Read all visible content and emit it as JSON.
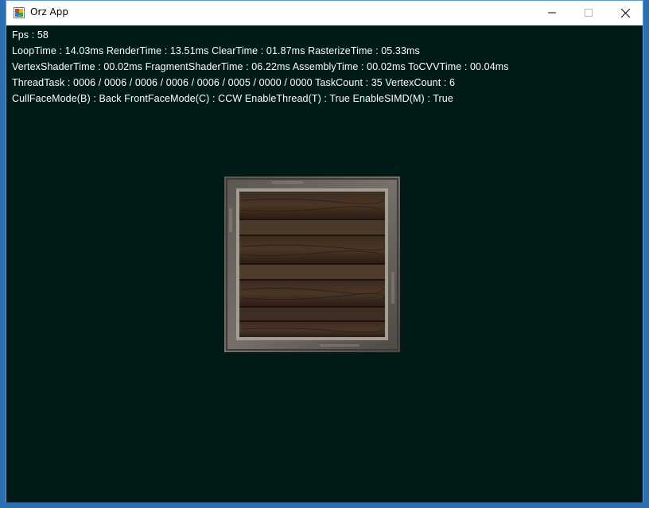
{
  "window": {
    "title": "Orz App"
  },
  "stats": {
    "fps_line": "Fps : 58",
    "time_line": "LoopTime : 14.03ms  RenderTime : 13.51ms  ClearTime : 01.87ms  RasterizeTime : 05.33ms",
    "shader_line": "VertexShaderTime : 00.02ms  FragmentShaderTime : 06.22ms  AssemblyTime : 00.02ms  ToCVVTime : 00.04ms",
    "thread_line": "ThreadTask : 0006 / 0006 / 0006 / 0006 / 0006 / 0005 / 0000 / 0000  TaskCount : 35  VertexCount : 6",
    "mode_line": "CullFaceMode(B) : Back  FrontFaceMode(C) : CCW  EnableThread(T) : True  EnableSIMD(M) : True"
  },
  "icons": {
    "app": "app-icon",
    "minimize": "minimize-icon",
    "maximize": "maximize-icon",
    "close": "close-icon"
  },
  "colors": {
    "viewport_bg": "#001a18",
    "text": "#ffffff",
    "crate_frame": "#6b645c",
    "crate_wood": "#3a2a1f"
  }
}
